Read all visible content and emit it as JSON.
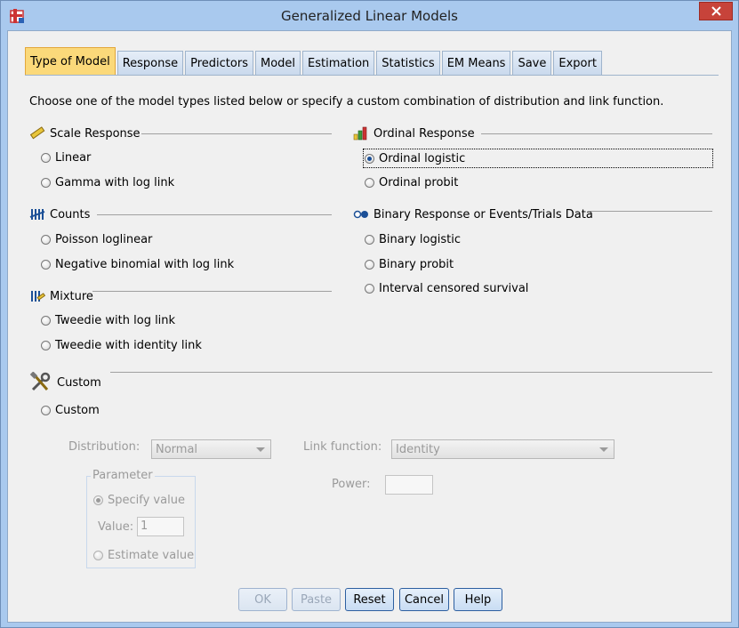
{
  "window": {
    "title": "Generalized Linear Models"
  },
  "tabs": [
    {
      "label": "Type of Model",
      "active": true
    },
    {
      "label": "Response"
    },
    {
      "label": "Predictors"
    },
    {
      "label": "Model"
    },
    {
      "label": "Estimation"
    },
    {
      "label": "Statistics"
    },
    {
      "label": "EM Means"
    },
    {
      "label": "Save"
    },
    {
      "label": "Export"
    }
  ],
  "intro_text": "Choose one of the model types listed below or specify a custom combination of distribution and link function.",
  "groups": {
    "scale": {
      "title": "Scale Response",
      "options": [
        "Linear",
        "Gamma with log link"
      ]
    },
    "counts": {
      "title": "Counts",
      "options": [
        "Poisson loglinear",
        "Negative binomial with log link"
      ]
    },
    "mixture": {
      "title": "Mixture",
      "options": [
        "Tweedie with log link",
        "Tweedie with identity link"
      ]
    },
    "ordinal": {
      "title": "Ordinal Response",
      "options": [
        "Ordinal logistic",
        "Ordinal probit"
      ],
      "selected": "Ordinal logistic"
    },
    "binary": {
      "title": "Binary Response or Events/Trials Data",
      "options": [
        "Binary logistic",
        "Binary probit",
        "Interval censored survival"
      ]
    },
    "custom": {
      "title": "Custom",
      "options": [
        "Custom"
      ]
    }
  },
  "custom_settings": {
    "distribution_label": "Distribution:",
    "distribution_value": "Normal",
    "link_label": "Link function:",
    "link_value": "Identity",
    "parameter_legend": "Parameter",
    "specify_value_label": "Specify value",
    "value_label": "Value:",
    "value": "1",
    "estimate_value_label": "Estimate value",
    "power_label": "Power:",
    "power_value": ""
  },
  "buttons": {
    "ok": "OK",
    "paste": "Paste",
    "reset": "Reset",
    "cancel": "Cancel",
    "help": "Help"
  },
  "colors": {
    "title_bar": "#a9c9ee",
    "active_tab": "#fbd97a",
    "close_button": "#c7433a",
    "dialog_bg": "#f0f0f0"
  }
}
